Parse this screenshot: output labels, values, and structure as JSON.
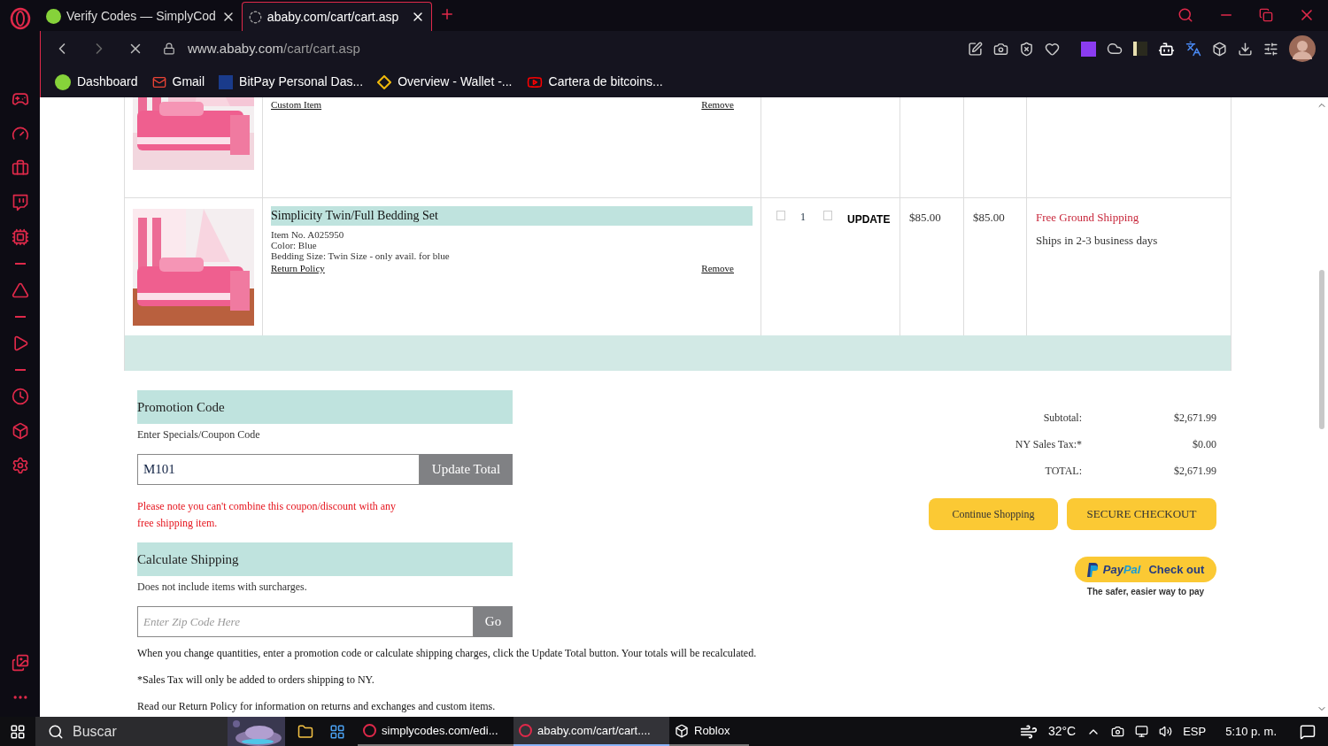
{
  "browser": {
    "tabs": [
      {
        "title": "Verify Codes — SimplyCod",
        "selected": false
      },
      {
        "title": "ababy.com/cart/cart.asp",
        "selected": true
      }
    ],
    "address": {
      "host": "www.ababy.com",
      "path": "/cart/cart.asp"
    },
    "bookmarks": [
      {
        "label": "Dashboard",
        "kind": "simplycodes"
      },
      {
        "label": "Gmail",
        "kind": "gmail"
      },
      {
        "label": "BitPay Personal Das...",
        "kind": "bitpay"
      },
      {
        "label": "Overview - Wallet -...",
        "kind": "binance"
      },
      {
        "label": "Cartera de bitcoins...",
        "kind": "youtube"
      }
    ]
  },
  "cart": {
    "rows": [
      {
        "kind": "partial",
        "title_link": "Custom Item",
        "remove": "Remove"
      },
      {
        "kind": "full",
        "title": "Simplicity Twin/Full Bedding Set",
        "details": [
          "Item No. A025950",
          "Color: Blue",
          "Bedding Size: Twin Size - only avail. for blue"
        ],
        "policy_link": "Return Policy",
        "remove": "Remove",
        "quantity": "1",
        "update": "UPDATE",
        "price": "$85.00",
        "total": "$85.00",
        "shipping_note": "Free Ground Shipping",
        "ships": "Ships in 2-3 business days"
      }
    ]
  },
  "promotion": {
    "title": "Promotion Code",
    "hint": "Enter Specials/Coupon Code",
    "value": "M101",
    "button": "Update Total",
    "note": "Please note you can't combine this coupon/discount with any free shipping item."
  },
  "shipping": {
    "title": "Calculate Shipping",
    "hint": "Does not include items with surcharges.",
    "placeholder": "Enter Zip Code Here",
    "button": "Go"
  },
  "notes": [
    "When you change quantities, enter a promotion code or calculate shipping charges, click the Update Total button. Your totals will be recalculated.",
    "*Sales Tax will only be added to orders shipping to NY.",
    "Read our Return Policy for information on returns and exchanges and custom items."
  ],
  "totals": [
    {
      "label": "Subtotal:",
      "value": "$2,671.99"
    },
    {
      "label": "NY Sales Tax:*",
      "value": "$0.00"
    },
    {
      "label": "TOTAL:",
      "value": "$2,671.99"
    }
  ],
  "actions": [
    "Continue Shopping",
    "SECURE CHECKOUT"
  ],
  "paypal": {
    "brand_a": "Pay",
    "brand_b": "Pal",
    "action": "Check out",
    "tagline": "The safer, easier way to pay"
  },
  "taskbar": {
    "search": "Buscar",
    "apps": [
      {
        "label": "simplycodes.com/edi...",
        "selected": false
      },
      {
        "label": "ababy.com/cart/cart....",
        "selected": true
      },
      {
        "label": "Roblox",
        "selected": false
      }
    ],
    "temperature": "32°C",
    "language": "ESP",
    "time": "5:10 p. m."
  }
}
